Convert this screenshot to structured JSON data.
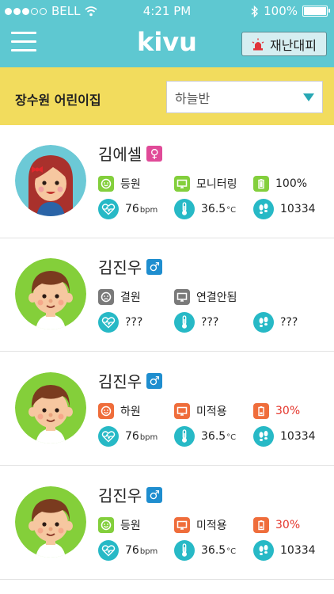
{
  "status_bar": {
    "carrier": "BELL",
    "time": "4:21 PM",
    "battery": "100%",
    "signal_bars": 3,
    "signal_total": 5
  },
  "header": {
    "logo": "kivu",
    "emergency_label": "재난대피"
  },
  "classbar": {
    "school_name": "장수원 어린이집",
    "selected_class": "하늘반"
  },
  "children": [
    {
      "name": "김에셀",
      "gender_symbol": "♀",
      "attendance": "등원",
      "monitor": "모니터링",
      "battery": "100%",
      "heart_rate": "76",
      "hr_unit": "bpm",
      "temperature": "36.5",
      "temp_unit": "°C",
      "steps": "10334"
    },
    {
      "name": "김진우",
      "gender_symbol": "♂",
      "attendance": "결원",
      "monitor": "연결안됨",
      "heart_rate": "???",
      "hr_unit": "",
      "temperature": "???",
      "temp_unit": "",
      "steps": "???"
    },
    {
      "name": "김진우",
      "gender_symbol": "♂",
      "attendance": "하원",
      "monitor": "미적용",
      "battery": "30%",
      "heart_rate": "76",
      "hr_unit": "bpm",
      "temperature": "36.5",
      "temp_unit": "°C",
      "steps": "10334"
    },
    {
      "name": "김진우",
      "gender_symbol": "♂",
      "attendance": "등원",
      "monitor": "미적용",
      "battery": "30%",
      "heart_rate": "76",
      "hr_unit": "bpm",
      "temperature": "36.5",
      "temp_unit": "°C",
      "steps": "10334"
    }
  ],
  "colors": {
    "header": "#5ec8d1",
    "classbar": "#f2dc5d",
    "accent": "#27b9c6",
    "ok": "#83cf3c",
    "warn": "#ef6d3b",
    "off": "#7a7a7a",
    "alert_text": "#e4352b"
  }
}
